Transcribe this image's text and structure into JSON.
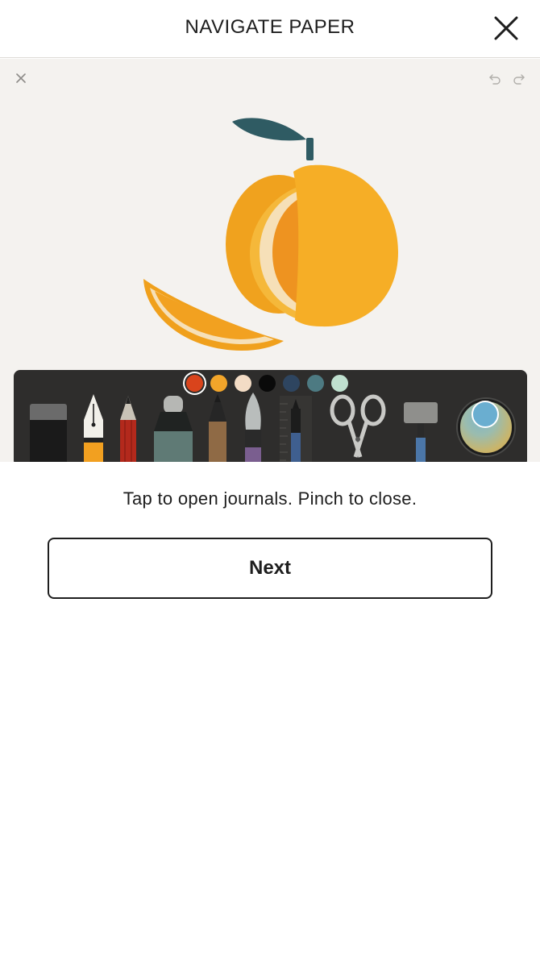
{
  "header": {
    "title": "NAVIGATE PAPER",
    "close_icon": "close-icon"
  },
  "canvas": {
    "background": "#f4f2ef",
    "close_icon": "close-icon",
    "undo_icon": "undo-icon",
    "redo_icon": "redo-icon",
    "illustration": "orange-with-slice"
  },
  "toolbar": {
    "swatches": [
      {
        "color": "#d9441c",
        "selected": true
      },
      {
        "color": "#f2a52a",
        "selected": false
      },
      {
        "color": "#f3dcc5",
        "selected": false
      },
      {
        "color": "#0a0a0a",
        "selected": false
      },
      {
        "color": "#2e4560",
        "selected": false
      },
      {
        "color": "#4d7a82",
        "selected": false
      },
      {
        "color": "#bfe0cf",
        "selected": false
      }
    ],
    "tools": [
      "eraser",
      "fountain-pen",
      "pencil",
      "marker",
      "fineliner",
      "watercolor-brush",
      "ruler-pen",
      "scissors",
      "fill-roller",
      "color-wheel"
    ]
  },
  "instruction": {
    "text": "Tap to open journals. Pinch to close."
  },
  "next_button": {
    "label": "Next"
  }
}
